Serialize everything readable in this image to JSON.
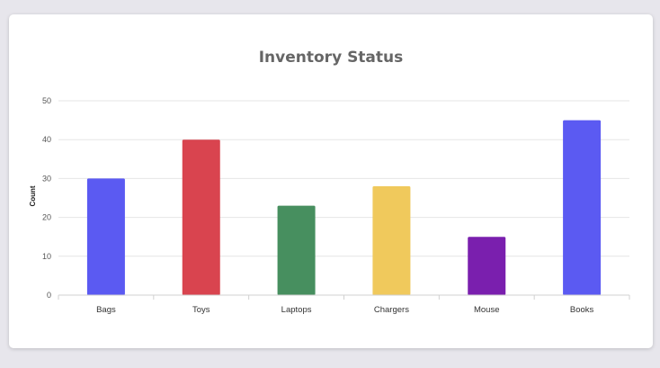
{
  "chart_data": {
    "type": "bar",
    "title": "Inventory Status",
    "xlabel": "",
    "ylabel": "Count",
    "ylim": [
      0,
      50
    ],
    "yticks": [
      0,
      10,
      20,
      30,
      40,
      50
    ],
    "grid": true,
    "categories": [
      "Bags",
      "Toys",
      "Laptops",
      "Chargers",
      "Mouse",
      "Books"
    ],
    "values": [
      30,
      40,
      23,
      28,
      15,
      45
    ],
    "colors": [
      "#5b5af2",
      "#d9444f",
      "#478f5f",
      "#f0c95c",
      "#7a1fae",
      "#5b5af2"
    ]
  }
}
